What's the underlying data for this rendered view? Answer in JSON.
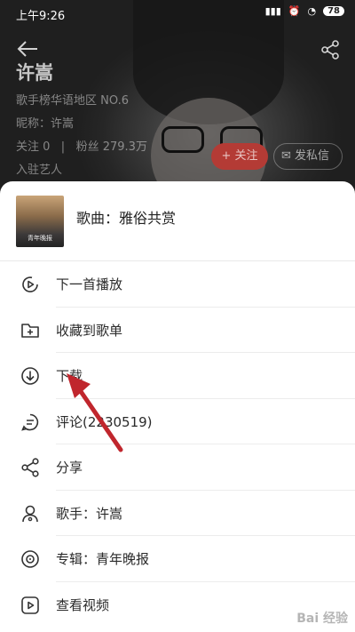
{
  "statusbar": {
    "time": "上午9:26",
    "battery": "78"
  },
  "artist": {
    "name": "许嵩",
    "rank": "歌手榜华语地区 NO.6",
    "nickname": "昵称：许嵩",
    "follows": "关注 0",
    "fans": "粉丝 279.3万",
    "resident": "入驻艺人",
    "follow_button": "+ 关注",
    "message_button": "发私信"
  },
  "sheet": {
    "song_title": "歌曲：雅俗共赏",
    "cover_text": "青年晚报",
    "items": [
      {
        "label": "下一首播放",
        "icon": "play-next-icon"
      },
      {
        "label": "收藏到歌单",
        "icon": "add-to-folder-icon"
      },
      {
        "label": "下载",
        "icon": "download-icon"
      },
      {
        "label": "评论(2230519)",
        "icon": "comment-icon"
      },
      {
        "label": "分享",
        "icon": "share-icon"
      },
      {
        "label": "歌手：许嵩",
        "icon": "singer-icon"
      },
      {
        "label": "专辑：青年晚报",
        "icon": "album-icon"
      },
      {
        "label": "查看视频",
        "icon": "video-icon"
      }
    ]
  },
  "annotation": {
    "arrow_color": "#c0262d"
  },
  "watermark": "Bai 经验"
}
